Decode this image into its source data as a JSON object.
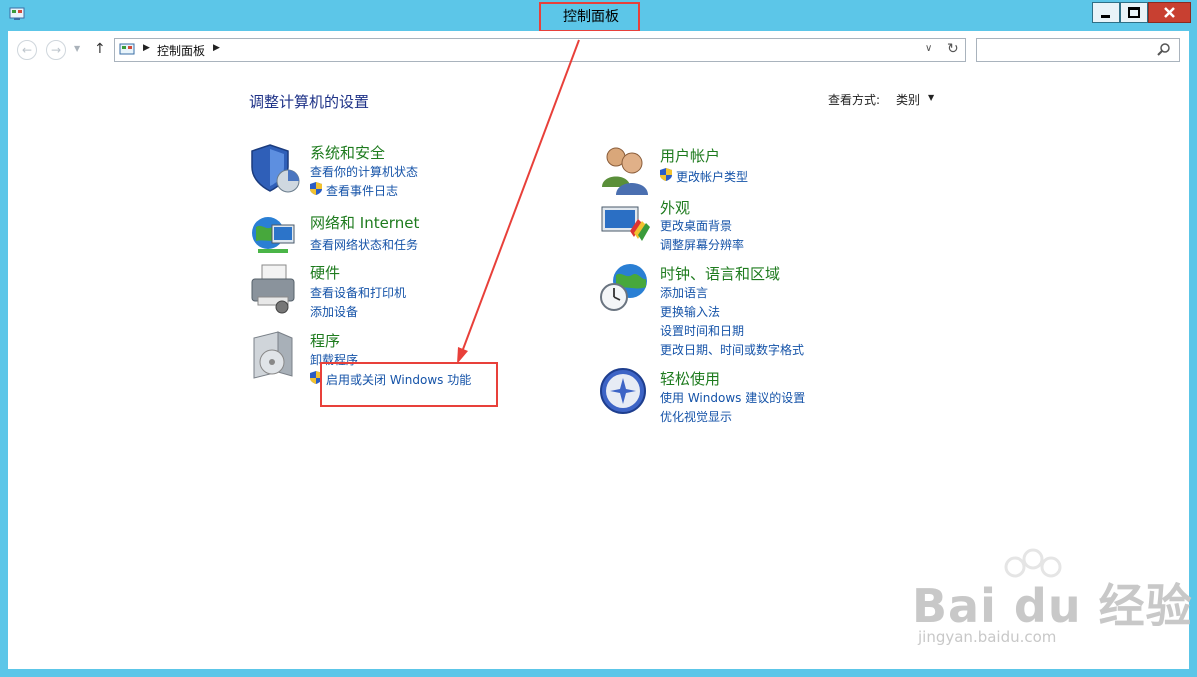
{
  "window": {
    "title": "控制面板"
  },
  "nav": {
    "breadcrumb": "控制面板"
  },
  "heading": "调整计算机的设置",
  "view_by": {
    "label": "查看方式:",
    "value": "类别"
  },
  "categories": [
    {
      "title": "系统和安全",
      "links": [
        "查看你的计算机状态",
        "查看事件日志"
      ]
    },
    {
      "title": "网络和 Internet",
      "links": [
        "查看网络状态和任务"
      ]
    },
    {
      "title": "硬件",
      "links": [
        "查看设备和打印机",
        "添加设备"
      ]
    },
    {
      "title": "程序",
      "links": [
        "卸载程序",
        "启用或关闭 Windows 功能"
      ]
    },
    {
      "title": "用户帐户",
      "links": [
        "更改帐户类型"
      ]
    },
    {
      "title": "外观",
      "links": [
        "更改桌面背景",
        "调整屏幕分辨率"
      ]
    },
    {
      "title": "时钟、语言和区域",
      "links": [
        "添加语言",
        "更换输入法",
        "设置时间和日期",
        "更改日期、时间或数字格式"
      ]
    },
    {
      "title": "轻松使用",
      "links": [
        "使用 Windows 建议的设置",
        "优化视觉显示"
      ]
    }
  ],
  "watermark": {
    "brand": "Bai du 经验",
    "url": "jingyan.baidu.com"
  },
  "colors": {
    "frame": "#5cc6e8",
    "link": "#1553a8",
    "category": "#1e7b1e",
    "heading": "#1e3287",
    "annotation": "#e8403a"
  }
}
